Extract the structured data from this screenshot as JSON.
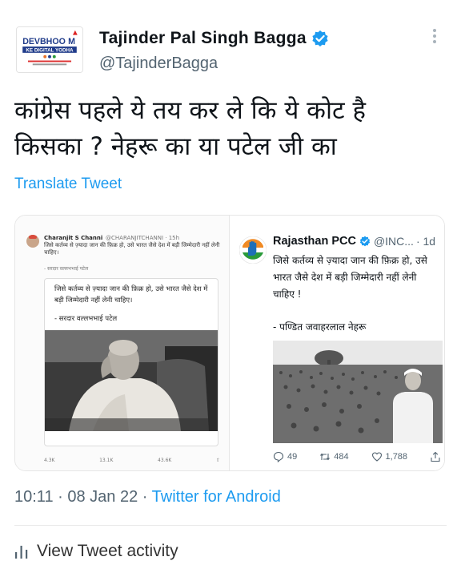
{
  "account": {
    "display_name": "Tajinder Pal Singh Bagga",
    "handle": "@TajinderBagga",
    "avatar_text_line1": "DEVBHOOMI",
    "avatar_text_line2": "KE DIGITAL YODHA"
  },
  "tweet": {
    "lines": [
      "कांग्रेस पहले ये तय कर ले कि ये कोट है",
      "किसका ? नेहरू का या पटेल जी का"
    ],
    "translate_label": "Translate Tweet",
    "time": "10:11",
    "date": "08 Jan 22",
    "source": "Twitter for Android",
    "separator": "·",
    "activity_label": "View Tweet activity"
  },
  "embedded_left": {
    "name": "Charanjit S Channi",
    "handle": "@CHARANJITCHANNI · 15h",
    "text": "जिसे कर्तव्य से ज़्यादा जान की फ़िक्र हो, उसे भारत जैसे देश में बड़ी जिम्मेदारी नहीं लेनी चाहिए।",
    "label": "- सरदार वल्लभभाई पटेल",
    "quote_text": "जिसे कर्तव्य से ज़्यादा जान की फ़िक्र हो, उसे भारत जैसे देश में बड़ी जिम्मेदारी नहीं लेनी चाहिए।",
    "quote_sign": "- सरदार वल्लभभाई पटेल",
    "replies": "4.3K",
    "retweets": "13.1K",
    "likes": "43.6K"
  },
  "embedded_right": {
    "name": "Rajasthan PCC",
    "handle": "@INC...",
    "time": "· 1d",
    "text": "जिसे कर्तव्य से ज़्यादा जान की फ़िक्र हो, उसे भारत जैसे देश में बड़ी जिम्मेदारी नहीं लेनी चाहिए !",
    "sign": "- पण्डित जवाहरलाल नेहरू",
    "replies": "49",
    "retweets": "484",
    "likes": "1,788"
  },
  "colors": {
    "link": "#1d9bf0",
    "secondary_text": "#536471",
    "primary_text": "#0f1419",
    "verified": "#1d9bf0"
  }
}
